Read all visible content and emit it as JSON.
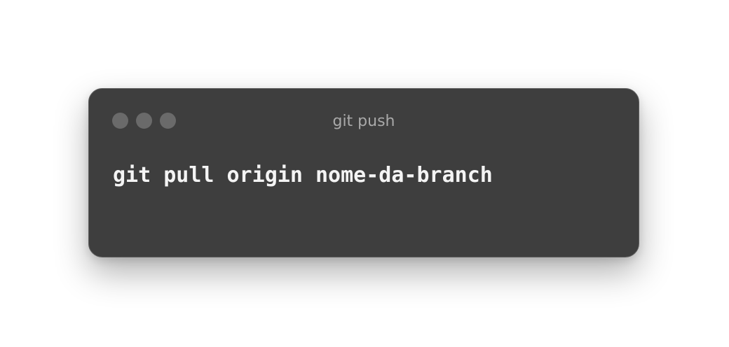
{
  "window": {
    "title": "git push",
    "controls": [
      "close",
      "minimize",
      "zoom"
    ],
    "colors": {
      "background": "#3e3e3e",
      "control_dot": "#6a6a6a",
      "title_text": "#a9a9a9",
      "command_text": "#f4f4f4"
    }
  },
  "terminal": {
    "command": "git pull origin nome-da-branch"
  }
}
